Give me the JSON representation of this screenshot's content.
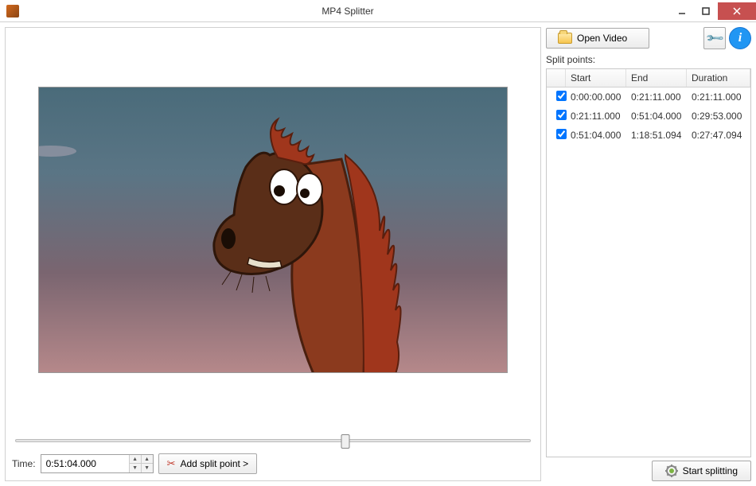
{
  "window": {
    "title": "MP4 Splitter"
  },
  "toolbar": {
    "open_label": "Open Video"
  },
  "split": {
    "label": "Split points:",
    "columns": {
      "start": "Start",
      "end": "End",
      "duration": "Duration"
    },
    "rows": [
      {
        "checked": true,
        "start": "0:00:00.000",
        "end": "0:21:11.000",
        "duration": "0:21:11.000"
      },
      {
        "checked": true,
        "start": "0:21:11.000",
        "end": "0:51:04.000",
        "duration": "0:29:53.000"
      },
      {
        "checked": true,
        "start": "0:51:04.000",
        "end": "1:18:51.094",
        "duration": "0:27:47.094"
      }
    ]
  },
  "time": {
    "label": "Time:",
    "value": "0:51:04.000"
  },
  "buttons": {
    "add_split": "Add split point >",
    "start_split": "Start splitting"
  }
}
